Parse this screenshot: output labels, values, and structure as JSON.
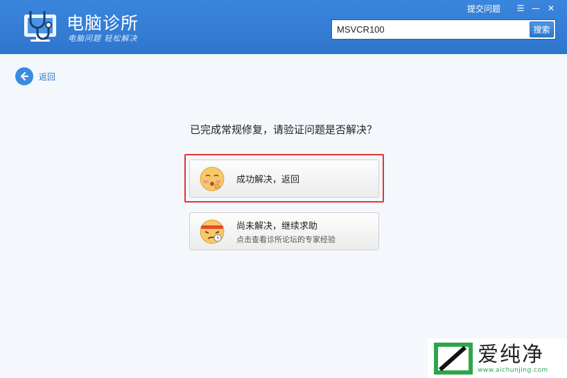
{
  "header": {
    "title": "电脑诊所",
    "slogan": "电脑问题 轻松解决",
    "feedback_link": "提交问题",
    "window_buttons": {
      "menu": "☰",
      "minimize": "—",
      "close": "✕"
    },
    "search": {
      "value": "MSVCR100",
      "button_label": "搜索"
    }
  },
  "nav": {
    "back_label": "返回"
  },
  "main": {
    "question": "已完成常规修复，请验证问题是否解决？",
    "options": [
      {
        "title": "成功解决，返回",
        "subtitle": "",
        "icon": "shy-smiley-icon"
      },
      {
        "title": "尚未解决，继续求助",
        "subtitle": "点击查看诊所论坛的专家经验",
        "icon": "worried-smiley-icon"
      }
    ]
  },
  "watermark": {
    "title": "爱纯净",
    "url": "www.aichunjing.com"
  },
  "colors": {
    "header_blue": "#2f76cd",
    "highlight_red": "#e0332f",
    "watermark_green": "#2ea54b"
  }
}
